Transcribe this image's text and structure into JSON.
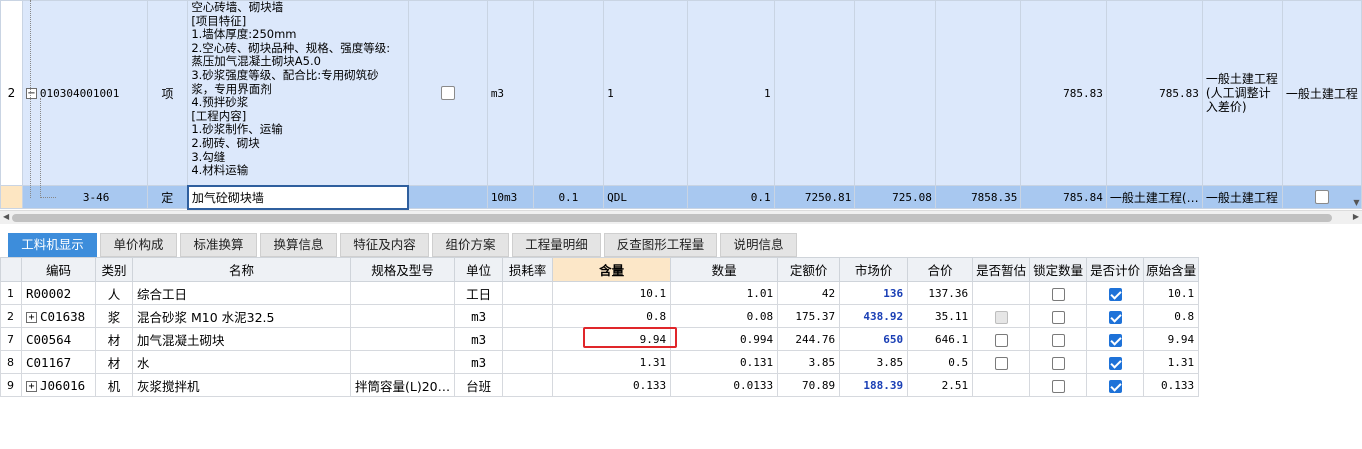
{
  "upper": {
    "row_main": {
      "index": "2",
      "code": "010304001001",
      "type": "项",
      "feature_text": "空心砖墙、砌块墙\n[项目特征]\n1.墙体厚度:250mm\n2.空心砖、砌块品种、规格、强度等级:\n蒸压加气混凝土砌块A5.0\n3.砂浆强度等级、配合比:专用砌筑砂\n浆，专用界面剂\n4.预拌砂浆\n[工程内容]\n1.砂浆制作、运输\n2.砌砖、砌块\n3.勾缝\n4.材料运输",
      "unit": "m3",
      "qty_expr": "1",
      "qty": "1",
      "price": "785.83",
      "total": "785.83",
      "category": "一般土建工程(人工调整计入差价)",
      "major": "一般土建工程"
    },
    "row_sub": {
      "code": "3-46",
      "type": "定",
      "name": "加气砼砌块墙",
      "unit": "10m3",
      "coef": "0.1",
      "qty_expr": "QDL",
      "qty": "0.1",
      "base_price": "7250.81",
      "col_a": "725.08",
      "col_b": "7858.35",
      "total": "785.84",
      "category": "一般土建工程(…",
      "major": "一般土建工程"
    }
  },
  "tabs": [
    {
      "label": "工料机显示",
      "active": true
    },
    {
      "label": "单价构成",
      "active": false
    },
    {
      "label": "标准换算",
      "active": false
    },
    {
      "label": "换算信息",
      "active": false
    },
    {
      "label": "特征及内容",
      "active": false
    },
    {
      "label": "组价方案",
      "active": false
    },
    {
      "label": "工程量明细",
      "active": false
    },
    {
      "label": "反查图形工程量",
      "active": false
    },
    {
      "label": "说明信息",
      "active": false
    }
  ],
  "lower": {
    "headers": [
      "",
      "编码",
      "类别",
      "名称",
      "规格及型号",
      "单位",
      "损耗率",
      "含量",
      "数量",
      "定额价",
      "市场价",
      "合价",
      "是否暂估",
      "锁定数量",
      "是否计价",
      "原始含量"
    ],
    "rows": [
      {
        "rn": "1",
        "code": "R00002",
        "expand": false,
        "cat": "人",
        "name": "综合工日",
        "spec": "",
        "unit": "工日",
        "loss": "",
        "content": "10.1",
        "qty": "1.01",
        "base": "42",
        "market": "136",
        "sum": "137.36",
        "est": "none",
        "lock": false,
        "priced": true,
        "orig": "10.1"
      },
      {
        "rn": "2",
        "code": "C01638",
        "expand": true,
        "cat": "浆",
        "name": "混合砂浆 M10 水泥32.5",
        "spec": "",
        "unit": "m3",
        "loss": "",
        "content": "0.8",
        "qty": "0.08",
        "base": "175.37",
        "market": "438.92",
        "sum": "35.11",
        "est": "disabled",
        "lock": false,
        "priced": true,
        "orig": "0.8"
      },
      {
        "rn": "7",
        "code": "C00564",
        "expand": false,
        "cat": "材",
        "name": "加气混凝土砌块",
        "spec": "",
        "unit": "m3",
        "loss": "",
        "content": "9.94",
        "qty": "0.994",
        "base": "244.76",
        "market": "650",
        "sum": "646.1",
        "est": "empty",
        "lock": false,
        "priced": true,
        "orig": "9.94"
      },
      {
        "rn": "8",
        "code": "C01167",
        "expand": false,
        "cat": "材",
        "name": "水",
        "spec": "",
        "unit": "m3",
        "loss": "",
        "content": "1.31",
        "qty": "0.131",
        "base": "3.85",
        "market": "3.85",
        "sum": "0.5",
        "est": "empty",
        "lock": false,
        "priced": true,
        "orig": "1.31"
      },
      {
        "rn": "9",
        "code": "J06016",
        "expand": true,
        "cat": "机",
        "name": "灰浆搅拌机",
        "spec": "拌筒容量(L)20…",
        "unit": "台班",
        "loss": "",
        "content": "0.133",
        "qty": "0.0133",
        "base": "70.89",
        "market": "188.39",
        "sum": "2.51",
        "est": "none",
        "lock": false,
        "priced": true,
        "orig": "0.133"
      }
    ]
  }
}
